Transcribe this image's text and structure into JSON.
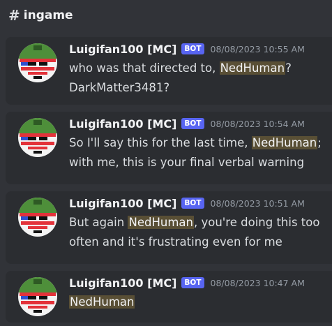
{
  "channel": {
    "hash": "#",
    "name": "ingame"
  },
  "messages": [
    {
      "author": "Luigifan100 [MC]",
      "badge": "BOT",
      "timestamp": "08/08/2023 10:55 AM",
      "pre": "who was that directed to, ",
      "mention": "NedHuman",
      "post": "? DarkMatter3481?"
    },
    {
      "author": "Luigifan100 [MC]",
      "badge": "BOT",
      "timestamp": "08/08/2023 10:54 AM",
      "pre": "So I'll say this for the last time, ",
      "mention": "NedHuman",
      "post": "; with me, this is your final verbal warning"
    },
    {
      "author": "Luigifan100 [MC]",
      "badge": "BOT",
      "timestamp": "08/08/2023 10:51 AM",
      "pre": "But again ",
      "mention": "NedHuman",
      "post": ", you're doing this too often and it's frustrating even for me"
    },
    {
      "author": "Luigifan100 [MC]",
      "badge": "BOT",
      "timestamp": "08/08/2023 10:47 AM",
      "pre": "",
      "mention": "NedHuman",
      "post": ""
    }
  ]
}
